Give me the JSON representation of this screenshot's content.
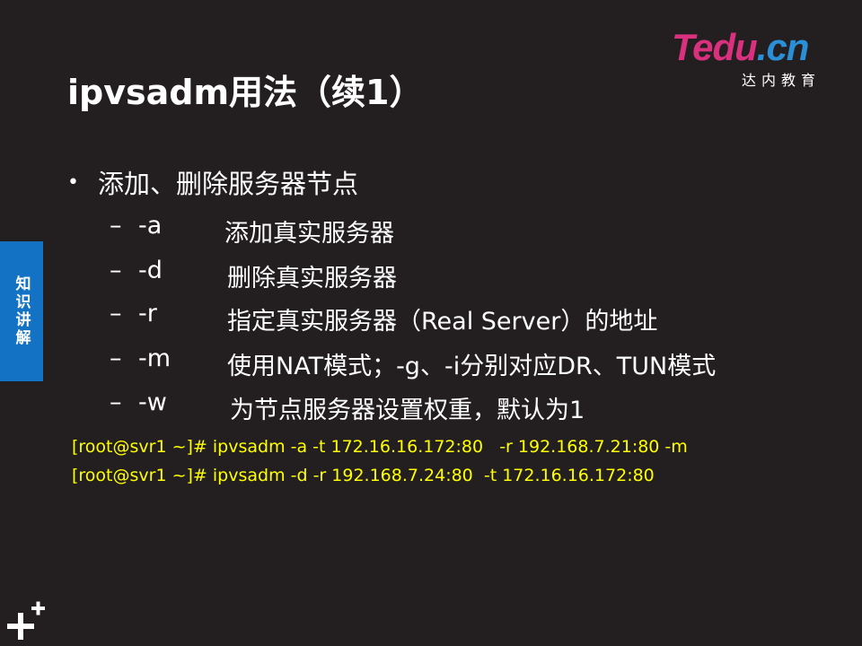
{
  "title": "ipvsadm用法（续1）",
  "logo": {
    "t": "T",
    "edu": "edu",
    "dot": ".",
    "cn": "cn",
    "subtitle": "达内教育"
  },
  "side_tab": "知识讲解",
  "bullet": "添加、删除服务器节点",
  "options": [
    {
      "dash": "–",
      "flag": "-a",
      "desc": "添加真实服务器"
    },
    {
      "dash": "–",
      "flag": "-d",
      "desc": "删除真实服务器"
    },
    {
      "dash": "–",
      "flag": "-r",
      "desc": "指定真实服务器（Real  Server）的地址"
    },
    {
      "dash": "–",
      "flag": "-m",
      "desc": "使用NAT模式；-g、-i分别对应DR、TUN模式"
    },
    {
      "dash": "–",
      "flag": "-w",
      "desc": "为节点服务器设置权重，默认为1"
    }
  ],
  "commands": [
    "[root@svr1 ~]# ipvsadm -a -t 172.16.16.172:80   -r 192.168.7.21:80 -m",
    "[root@svr1 ~]# ipvsadm -d -r 192.168.7.24:80  -t 172.16.16.172:80"
  ],
  "colors": {
    "background": "#231f20",
    "command_text": "#ffff00",
    "side_tab": "#1472c4",
    "logo_pink": "#d9317e",
    "logo_blue": "#2a8fd6"
  },
  "icons": {
    "bottom_left": "plus-plus-icon"
  }
}
